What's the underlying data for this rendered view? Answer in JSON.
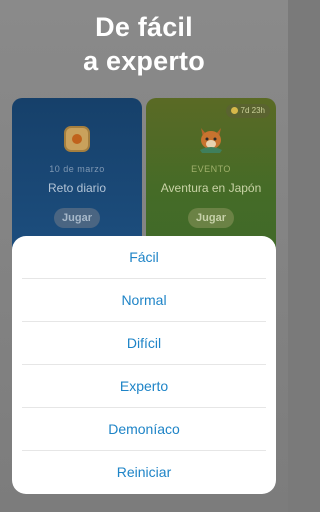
{
  "headline": {
    "line1": "De fácil",
    "line2": "a experto"
  },
  "cards": {
    "daily": {
      "date": "10 de marzo",
      "title": "Reto diario",
      "play": "Jugar",
      "icon": "calendar-badge-icon"
    },
    "event": {
      "timer": "7d 23h",
      "kind": "EVENTO",
      "title": "Aventura en Japón",
      "play": "Jugar",
      "icon": "fox-mascot-icon"
    }
  },
  "menu": {
    "options": [
      "Fácil",
      "Normal",
      "Difícil",
      "Experto",
      "Demoníaco",
      "Reiniciar"
    ]
  },
  "colors": {
    "option_text": "#1e84c7",
    "overlay": "#7c7c7c",
    "sheet": "#ffffff"
  }
}
